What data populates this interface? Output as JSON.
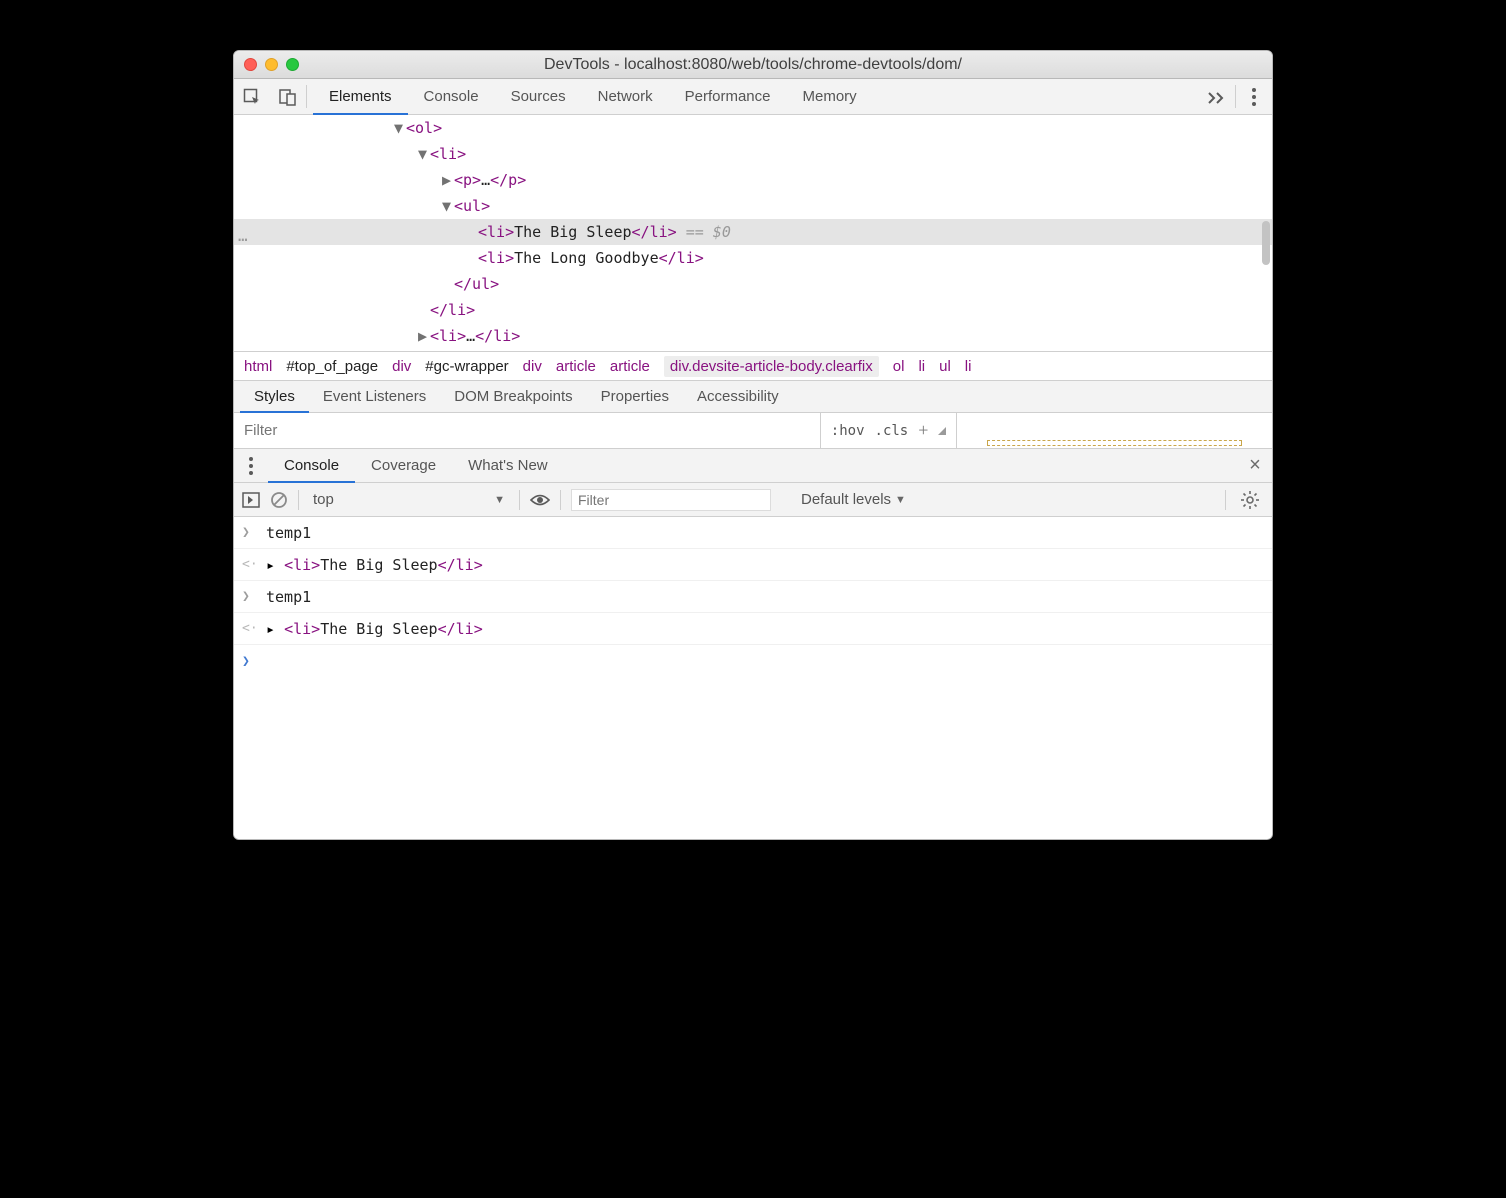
{
  "window": {
    "title": "DevTools - localhost:8080/web/tools/chrome-devtools/dom/"
  },
  "main_tabs": {
    "items": [
      "Elements",
      "Console",
      "Sources",
      "Network",
      "Performance",
      "Memory"
    ],
    "active": "Elements"
  },
  "dom": {
    "lines": [
      {
        "indent": 160,
        "arrow": "▼",
        "open": "<ol>",
        "text": "",
        "close": "",
        "suffix": "",
        "selected": false
      },
      {
        "indent": 184,
        "arrow": "▼",
        "open": "<li>",
        "text": "",
        "close": "",
        "suffix": "",
        "selected": false
      },
      {
        "indent": 208,
        "arrow": "▶",
        "open": "<p>",
        "text": "…",
        "close": "</p>",
        "suffix": "",
        "selected": false
      },
      {
        "indent": 208,
        "arrow": "▼",
        "open": "<ul>",
        "text": "",
        "close": "",
        "suffix": "",
        "selected": false
      },
      {
        "indent": 244,
        "arrow": "",
        "open": "<li>",
        "text": "The Big Sleep",
        "close": "</li>",
        "suffix": " == $0",
        "selected": true
      },
      {
        "indent": 244,
        "arrow": "",
        "open": "<li>",
        "text": "The Long Goodbye",
        "close": "</li>",
        "suffix": "",
        "selected": false
      },
      {
        "indent": 220,
        "arrow": "",
        "open": "</ul>",
        "text": "",
        "close": "",
        "suffix": "",
        "selected": false
      },
      {
        "indent": 196,
        "arrow": "",
        "open": "</li>",
        "text": "",
        "close": "",
        "suffix": "",
        "selected": false
      },
      {
        "indent": 184,
        "arrow": "▶",
        "open": "<li>",
        "text": "…",
        "close": "</li>",
        "suffix": "",
        "selected": false
      }
    ]
  },
  "breadcrumb": {
    "items": [
      {
        "label": "html",
        "kind": "tag"
      },
      {
        "label": "#top_of_page",
        "kind": "sel"
      },
      {
        "label": "div",
        "kind": "tag"
      },
      {
        "label": "#gc-wrapper",
        "kind": "sel"
      },
      {
        "label": "div",
        "kind": "tag"
      },
      {
        "label": "article",
        "kind": "tag"
      },
      {
        "label": "article",
        "kind": "tag"
      },
      {
        "label": "div.devsite-article-body.clearfix",
        "kind": "highlight"
      },
      {
        "label": "ol",
        "kind": "tag"
      },
      {
        "label": "li",
        "kind": "tag"
      },
      {
        "label": "ul",
        "kind": "tag"
      },
      {
        "label": "li",
        "kind": "tag"
      }
    ]
  },
  "styles_tabs": {
    "items": [
      "Styles",
      "Event Listeners",
      "DOM Breakpoints",
      "Properties",
      "Accessibility"
    ],
    "active": "Styles"
  },
  "filter": {
    "placeholder": "Filter",
    "hov": ":hov",
    "cls": ".cls"
  },
  "drawer_tabs": {
    "items": [
      "Console",
      "Coverage",
      "What's New"
    ],
    "active": "Console"
  },
  "console_toolbar": {
    "context": "top",
    "filter_placeholder": "Filter",
    "levels": "Default levels"
  },
  "console_entries": [
    {
      "icon": ">",
      "kind": "input",
      "text": "temp1"
    },
    {
      "icon": "<",
      "kind": "output",
      "tag_open": "<li>",
      "value": "The Big Sleep",
      "tag_close": "</li>"
    },
    {
      "icon": ">",
      "kind": "input",
      "text": "temp1"
    },
    {
      "icon": "<",
      "kind": "output",
      "tag_open": "<li>",
      "value": "The Big Sleep",
      "tag_close": "</li>"
    }
  ]
}
